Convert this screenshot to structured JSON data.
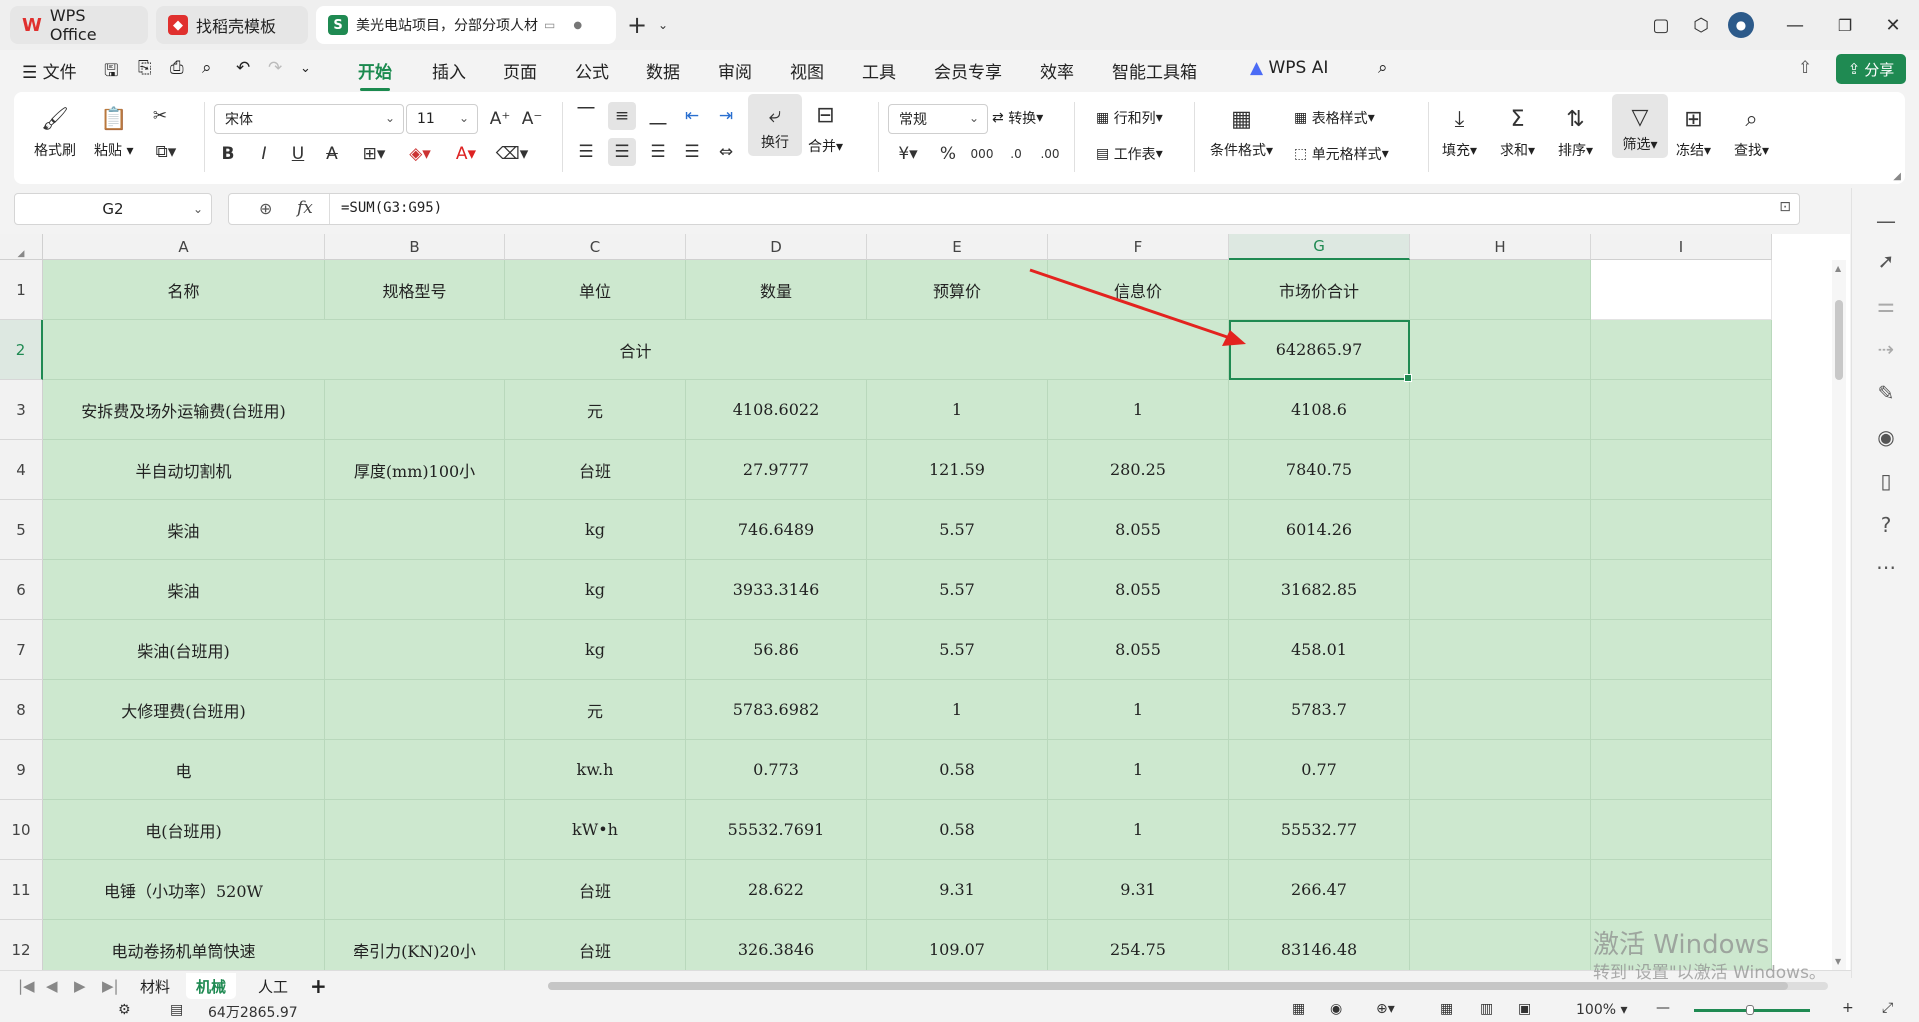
{
  "titlebar": {
    "tabs": [
      {
        "label": "WPS Office",
        "icon": "wps-logo-icon",
        "color": "#e0302e"
      },
      {
        "label": "找稻壳模板",
        "icon": "docer-icon",
        "color": "#e0302e"
      },
      {
        "label": "美光电站项目，分部分项人材",
        "icon": "spreadsheet-icon",
        "color": "#1f8a52"
      }
    ],
    "new_tab": "+"
  },
  "menu": {
    "file": "文件",
    "items": [
      "开始",
      "插入",
      "页面",
      "公式",
      "数据",
      "审阅",
      "视图",
      "工具",
      "会员专享",
      "效率",
      "智能工具箱"
    ],
    "active": "开始",
    "wps_ai": "WPS AI",
    "share": "分享"
  },
  "ribbon": {
    "format_painter": "格式刷",
    "paste": "粘贴",
    "font_name": "宋体",
    "font_size": "11",
    "wrap": "换行",
    "merge": "合并",
    "number_format": "常规",
    "convert": "转换",
    "rows_cols": "行和列",
    "worksheet": "工作表",
    "cond_format": "条件格式",
    "table_style": "表格样式",
    "cell_style": "单元格样式",
    "fill": "填充",
    "sum": "求和",
    "sort": "排序",
    "filter": "筛选",
    "freeze": "冻结",
    "find": "查找"
  },
  "formula_bar": {
    "cell_ref": "G2",
    "fx": "fx",
    "formula": "=SUM(G3:G95)"
  },
  "grid": {
    "columns": [
      "A",
      "B",
      "C",
      "D",
      "E",
      "F",
      "G",
      "H",
      "I"
    ],
    "selected_column": "G",
    "header": [
      "名称",
      "规格型号",
      "单位",
      "数量",
      "预算价",
      "信息价",
      "市场价合计"
    ],
    "total_label": "合计",
    "total_value": "642865.97",
    "rows": [
      {
        "num": "3",
        "cells": [
          "安拆费及场外运输费(台班用)",
          "",
          "元",
          "4108.6022",
          "1",
          "1",
          "4108.6"
        ]
      },
      {
        "num": "4",
        "cells": [
          "半自动切割机",
          "厚度(mm)100小",
          "台班",
          "27.9777",
          "121.59",
          "280.25",
          "7840.75"
        ]
      },
      {
        "num": "5",
        "cells": [
          "柴油",
          "",
          "kg",
          "746.6489",
          "5.57",
          "8.055",
          "6014.26"
        ]
      },
      {
        "num": "6",
        "cells": [
          "柴油",
          "",
          "kg",
          "3933.3146",
          "5.57",
          "8.055",
          "31682.85"
        ]
      },
      {
        "num": "7",
        "cells": [
          "柴油(台班用)",
          "",
          "kg",
          "56.86",
          "5.57",
          "8.055",
          "458.01"
        ]
      },
      {
        "num": "8",
        "cells": [
          "大修理费(台班用)",
          "",
          "元",
          "5783.6982",
          "1",
          "1",
          "5783.7"
        ]
      },
      {
        "num": "9",
        "cells": [
          "电",
          "",
          "kw.h",
          "0.773",
          "0.58",
          "1",
          "0.77"
        ]
      },
      {
        "num": "10",
        "cells": [
          "电(台班用)",
          "",
          "kW•h",
          "55532.7691",
          "0.58",
          "1",
          "55532.77"
        ]
      },
      {
        "num": "11",
        "cells": [
          "电锤（小功率）520W",
          "",
          "台班",
          "28.622",
          "9.31",
          "9.31",
          "266.47"
        ]
      },
      {
        "num": "12",
        "cells": [
          "电动卷扬机单筒快速",
          "牵引力(KN)20小",
          "台班",
          "326.3846",
          "109.07",
          "254.75",
          "83146.48"
        ]
      }
    ]
  },
  "sheets": [
    "材料",
    "机械",
    "人工"
  ],
  "active_sheet": "机械",
  "status": {
    "sum": "64万2865.97",
    "zoom": "100%"
  },
  "watermark": {
    "line1": "激活 Windows",
    "line2": "转到\"设置\"以激活 Windows。"
  },
  "colors": {
    "accent": "#1f8a52",
    "cell_fill": "#cde8cf",
    "arrow": "#e3231f"
  }
}
